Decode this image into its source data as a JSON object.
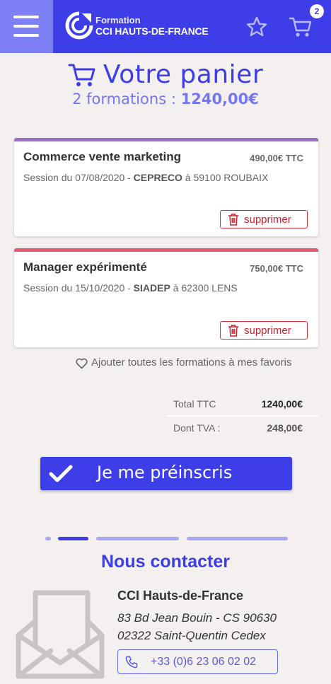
{
  "header": {
    "brand_line1": "Formation",
    "brand_line2": "CCI HAUTS-DE-FRANCE",
    "cart_count": "2",
    "color_primary": "#3e3ee8",
    "color_menu": "#7e7ef5",
    "icons": [
      "menu-icon",
      "cci-logo",
      "star-icon",
      "cart-icon"
    ]
  },
  "cart": {
    "title": "Votre panier",
    "summary_count": "2 formations :",
    "summary_total": "1240,00€"
  },
  "items": [
    {
      "name": "Commerce vente marketing",
      "price": "490,00€ TTC",
      "session_prefix": "Session du 07/08/2020 -",
      "organism": "CEPRECO",
      "location": "à 59100 ROUBAIX",
      "delete_label": "supprimer",
      "stripe_color": "#9b6dc6"
    },
    {
      "name": "Manager expérimenté",
      "price": "750,00€ TTC",
      "session_prefix": "Session du 15/10/2020 -",
      "organism": "SIADEP",
      "location": "à 62300 LENS",
      "delete_label": "supprimer",
      "stripe_color": "#e45a72"
    }
  ],
  "favorites_label": "Ajouter toutes les formations à mes favoris",
  "totals": {
    "total_label": "Total TTC",
    "total_value": "1240,00€",
    "tva_label": "Dont TVA :",
    "tva_value": "248,00€"
  },
  "cta_label": "Je me préinscris",
  "contact": {
    "title": "Nous contacter",
    "org": "CCI Hauts-de-France",
    "address_line1": "83 Bd Jean Bouin - CS 90630",
    "address_line2": "02322 Saint-Quentin Cedex",
    "phone": "+33 (0)6 23 06 02 02"
  }
}
